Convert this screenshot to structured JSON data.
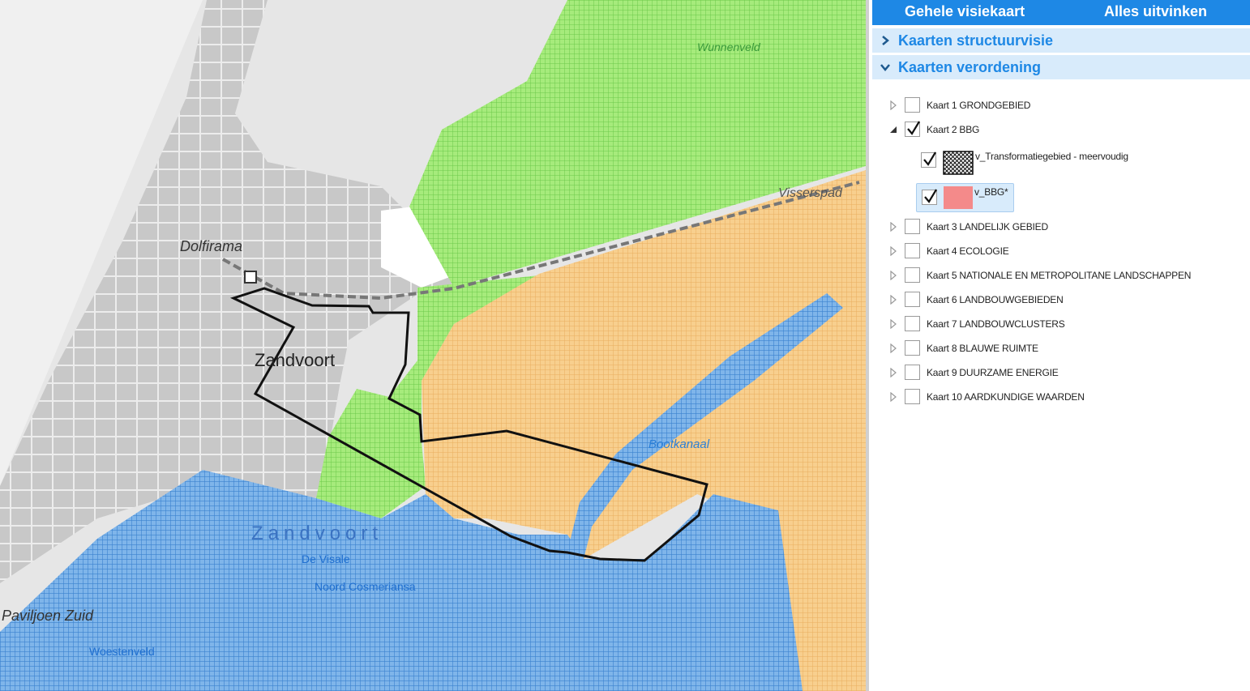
{
  "toolbar": {
    "whole_map_label": "Gehele visiekaart",
    "uncheck_all_label": "Alles uitvinken"
  },
  "sections": [
    {
      "label": "Kaarten structuurvisie",
      "expanded": false
    },
    {
      "label": "Kaarten verordening",
      "expanded": true
    }
  ],
  "layers": [
    {
      "label": "Kaart 1 GRONDGEBIED",
      "checked": false,
      "expanded": false
    },
    {
      "label": "Kaart 2 BBG",
      "checked": true,
      "expanded": true
    },
    {
      "label": "Kaart 3 LANDELIJK GEBIED",
      "checked": false,
      "expanded": false
    },
    {
      "label": "Kaart 4 ECOLOGIE",
      "checked": false,
      "expanded": false
    },
    {
      "label": "Kaart 5 NATIONALE EN METROPOLITANE LANDSCHAPPEN",
      "checked": false,
      "expanded": false
    },
    {
      "label": "Kaart 6 LANDBOUWGEBIEDEN",
      "checked": false,
      "expanded": false
    },
    {
      "label": "Kaart 7 LANDBOUWCLUSTERS",
      "checked": false,
      "expanded": false
    },
    {
      "label": "Kaart 8 BLAUWE RUIMTE",
      "checked": false,
      "expanded": false
    },
    {
      "label": "Kaart 9 DUURZAME ENERGIE",
      "checked": false,
      "expanded": false
    },
    {
      "label": "Kaart 10 AARDKUNDIGE WAARDEN",
      "checked": false,
      "expanded": false
    }
  ],
  "sublayers": [
    {
      "label": "v_Transformatiegebied - meervoudig",
      "checked": true,
      "swatch": "hatch"
    },
    {
      "label": "v_BBG*",
      "checked": true,
      "swatch": "#f48a8a",
      "selected": true
    }
  ],
  "map_labels": {
    "dolfirama": "Dolfirama",
    "zandvoort": "Zandvoort",
    "zandvoort_water": "Zandvoort",
    "de_vissen": "De Visale",
    "noord_cosmenansa": "Noord Cosmeriansa",
    "paviljoen": "Paviljoen Zuid",
    "vissersbaai": "Visserspad",
    "wunnenveld": "Wunnenveld",
    "kanaal": "Bootkanaal",
    "woestenveld": "Woestenveld"
  },
  "colors": {
    "accent": "#1e88e5",
    "section_bg": "#d8ebfb",
    "green": "#8ee06a",
    "orange": "#f7c27a",
    "blue": "#4a8fd6",
    "boundary": "#111111",
    "urban": "#c6c6c6"
  }
}
